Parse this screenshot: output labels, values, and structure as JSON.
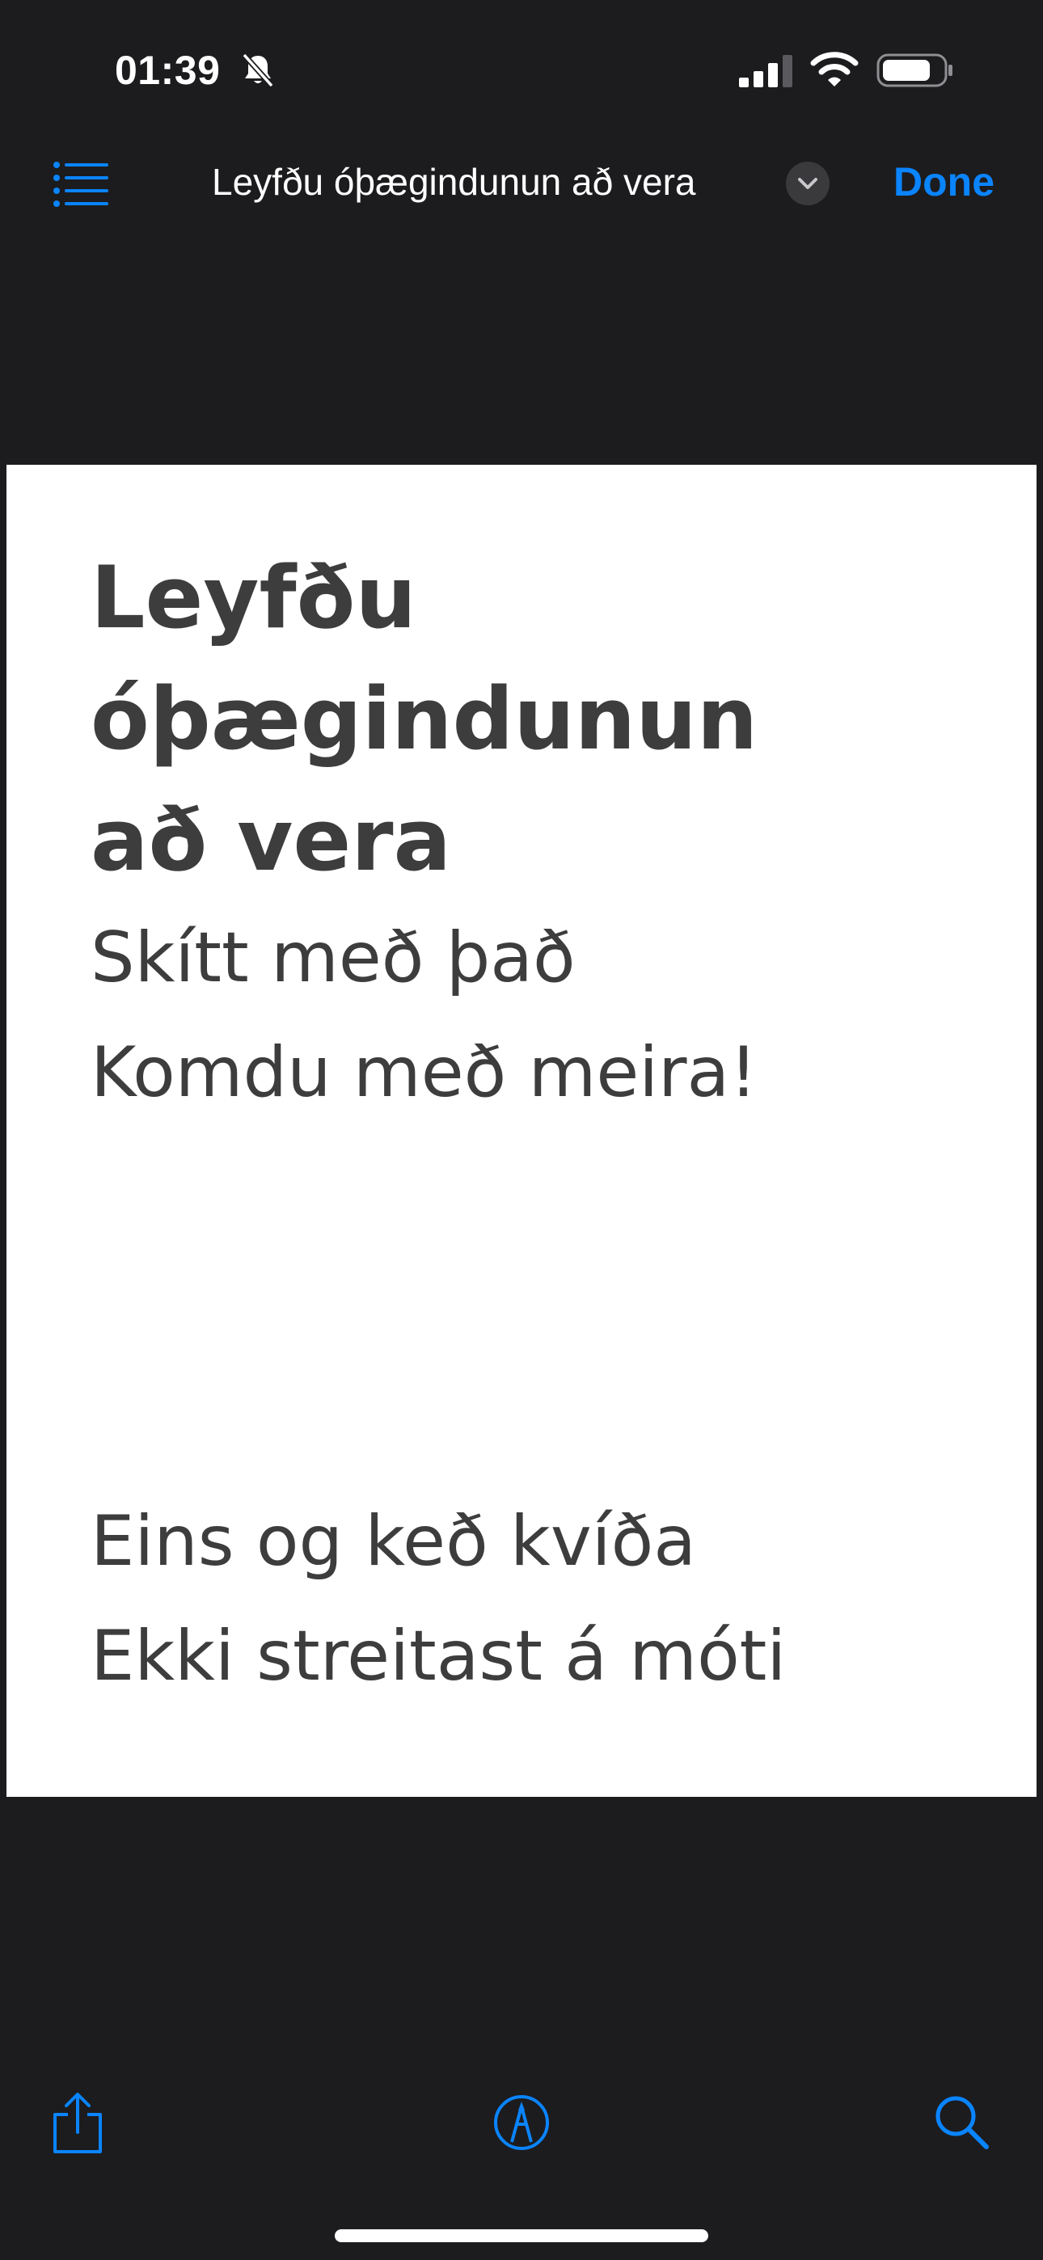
{
  "status_bar": {
    "time": "01:39",
    "icons": [
      "bell-slash-icon",
      "cellular-signal-icon",
      "wifi-icon",
      "battery-icon"
    ]
  },
  "nav_bar": {
    "menu_icon": "list-icon",
    "title": "Leyfðu óþægindunun að vera",
    "title_menu_icon": "chevron-down-icon",
    "done_label": "Done"
  },
  "document": {
    "heading": "Leyfðu óþægindunun að vera",
    "lines": [
      "Skítt með það",
      "Komdu með meira!",
      "Eins og keð kvíða",
      "Ekki streitast á móti"
    ]
  },
  "toolbar": {
    "icons": [
      "share-icon",
      "markup-icon",
      "search-icon"
    ]
  },
  "colors": {
    "background": "#1c1c1e",
    "accent": "#0a84ff",
    "page": "#ffffff",
    "page_text": "#3d3d3d"
  }
}
